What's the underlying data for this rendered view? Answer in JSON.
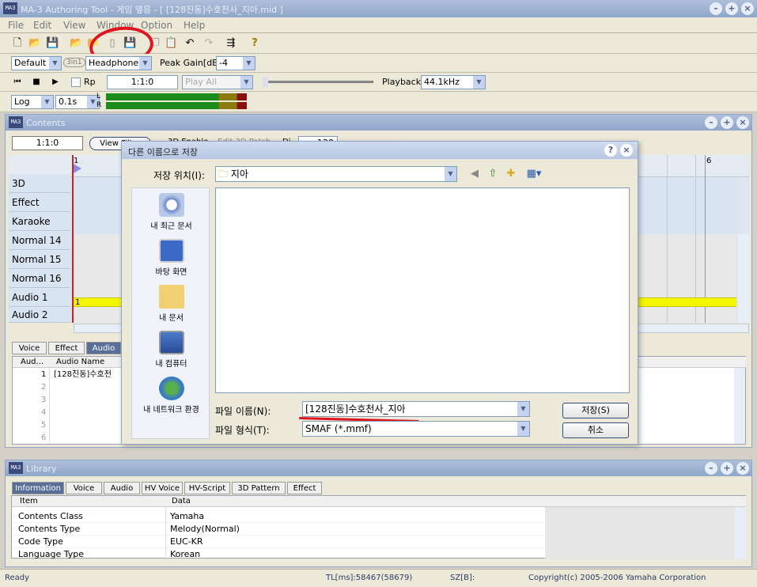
{
  "window": {
    "title": "MA-3 Authoring Tool - 게임 옆음 - [ [128진동]수호천사_지아.mid ]",
    "icon_text": "MA3"
  },
  "menu": [
    "File",
    "Edit",
    "View",
    "Window",
    "Option",
    "Help"
  ],
  "toolbar2": {
    "preset": "Default",
    "mode": "3in1",
    "output": "Headphone",
    "peak_label": "Peak Gain[dB]",
    "peak_value": "-4"
  },
  "transport": {
    "rp_label": "Rp",
    "position": "1:1:0",
    "play_mode": "Play All",
    "playback_label": "Playback",
    "rate": "44.1kHz"
  },
  "meter": {
    "scale": "Log",
    "interval": "0.1s",
    "l": "L",
    "r": "R"
  },
  "contents": {
    "title": "Contents",
    "position": "1:1:0",
    "view_filter": "View Filter",
    "enable_3d": "3D Enable",
    "edit_3d": "Edit 3D Patch",
    "di_label": "Di",
    "di_value": "120",
    "bar_markers": [
      "1",
      "6"
    ],
    "tracks": [
      "3D",
      "Effect",
      "Karaoke",
      "Normal 14",
      "Normal 15",
      "Normal 16",
      "Audio 1",
      "Audio 2"
    ],
    "audio_clip_label": "1"
  },
  "lower_tabs": [
    "Voice",
    "Effect",
    "Audio"
  ],
  "audio_list": {
    "headers": [
      "Aud...",
      "Audio Name"
    ],
    "rows": [
      {
        "n": "1",
        "name": "[128진동]수호천"
      },
      {
        "n": "2",
        "name": ""
      },
      {
        "n": "3",
        "name": ""
      },
      {
        "n": "4",
        "name": ""
      },
      {
        "n": "5",
        "name": ""
      },
      {
        "n": "6",
        "name": ""
      }
    ]
  },
  "dialog": {
    "title": "다른 이름으로 저장",
    "location_label": "저장 위치(I):",
    "location_value": "지아",
    "places": [
      "내 최근 문서",
      "바탕 화면",
      "내 문서",
      "내 컴퓨터",
      "내 네트워크 환경"
    ],
    "filename_label": "파일 이름(N):",
    "filename_value": "[128진동]수호천사_지아",
    "filetype_label": "파일 형식(T):",
    "filetype_value": "SMAF (*.mmf)",
    "save_button": "저장(S)",
    "cancel_button": "취소"
  },
  "library": {
    "title": "Library",
    "tabs": [
      "Information",
      "Voice",
      "Audio",
      "HV Voice",
      "HV-Script",
      "3D Pattern",
      "Effect"
    ],
    "headers": [
      "Item",
      "Data"
    ],
    "rows": [
      {
        "item": "Contents Class",
        "data": "Yamaha"
      },
      {
        "item": "Contents Type",
        "data": "Melody(Normal)"
      },
      {
        "item": "Code Type",
        "data": "EUC-KR"
      },
      {
        "item": "Language Type",
        "data": "Korean"
      }
    ]
  },
  "status": {
    "ready": "Ready",
    "tl": "TL[ms]:58467(58679)",
    "sz": "SZ[B]:",
    "copyright": "Copyright(c) 2005-2006 Yamaha Corporation"
  },
  "colors": {
    "annotation_red": "#e0141e",
    "clip_yellow": "#f5f500",
    "meter_green": "#1a8a1a",
    "meter_red": "#8a1010"
  }
}
